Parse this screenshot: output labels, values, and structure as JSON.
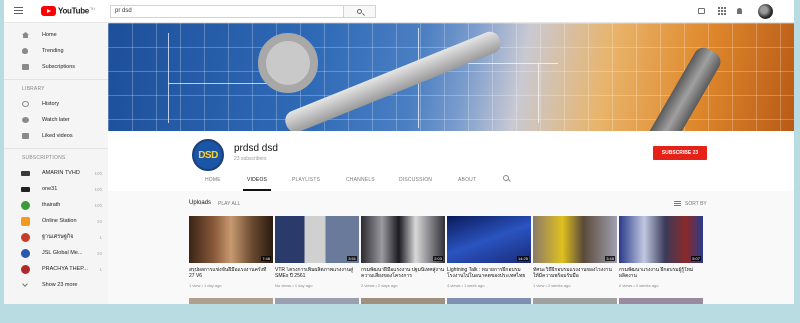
{
  "header": {
    "logo_text": "YouTube",
    "logo_suffix": "TH",
    "search_value": "pr dsd"
  },
  "sidebar": {
    "main": [
      {
        "label": "Home",
        "icon": "home-icon"
      },
      {
        "label": "Trending",
        "icon": "flame-icon"
      },
      {
        "label": "Subscriptions",
        "icon": "subscriptions-icon"
      }
    ],
    "library_heading": "LIBRARY",
    "library": [
      {
        "label": "History",
        "icon": "history-icon"
      },
      {
        "label": "Watch later",
        "icon": "clock-icon"
      },
      {
        "label": "Liked videos",
        "icon": "thumbs-up-icon"
      }
    ],
    "subscriptions_heading": "SUBSCRIPTIONS",
    "subscriptions": [
      {
        "label": "AMARIN TVHD",
        "count": "100",
        "color": "#3a3a3a"
      },
      {
        "label": "one31",
        "count": "100",
        "color": "#222222"
      },
      {
        "label": "thairath",
        "count": "100",
        "color": "#3c9a3a"
      },
      {
        "label": "Online Station",
        "count": "20",
        "color": "#f29a1f"
      },
      {
        "label": "ฐานเศรษฐกิจ",
        "count": "1",
        "color": "#c83c2a"
      },
      {
        "label": "JSL Global Me...",
        "count": "20",
        "color": "#2a56b0"
      },
      {
        "label": "PRACHYA THEP...",
        "count": "1",
        "color": "#b02a2a"
      }
    ],
    "show_more": "Show 23 more"
  },
  "channel": {
    "avatar_text": "DSD",
    "name": "prdsd dsd",
    "subscribers": "23 subscribers",
    "subscribe_label": "SUBSCRIBE 23",
    "tabs": [
      "HOME",
      "VIDEOS",
      "PLAYLISTS",
      "CHANNELS",
      "DISCUSSION",
      "ABOUT"
    ],
    "active_tab": "VIDEOS"
  },
  "uploads": {
    "title": "Uploads",
    "play_all": "PLAY ALL",
    "sort_by": "SORT BY",
    "videos": [
      {
        "title": "สรุปผลการแข่งขันฝีมือแรงงานครั้งที่ 27 V6",
        "meta": "1 view • 1 day ago",
        "duration": "7:48",
        "colors": [
          "#5a3a26",
          "#c8a07a"
        ]
      },
      {
        "title": "VTR โครงการเพิ่มผลิตภาพแรงงานสู่ SMEs ปี 2561",
        "meta": "No views • 1 day ago",
        "duration": "3:51",
        "colors": [
          "#3a4e7a",
          "#dcdcdc"
        ]
      },
      {
        "title": "กรมพัฒนาฝีมือแรงงาน ปฐมนิเทศสู่งานความเสี่ยงของโครงการ",
        "meta": "2 views • 2 days ago",
        "duration": "2:03",
        "colors": [
          "#2a2a30",
          "#cfcfcf"
        ]
      },
      {
        "title": "Lightning Talk : หมายการฝึกอบรมโรงงานไปในอนาคตของประเทศไทย",
        "meta": "4 views • 1 week ago",
        "duration": "14:25",
        "colors": [
          "#1a2a7a",
          "#3a64d0"
        ]
      },
      {
        "title": "ทัศนะวิถีฝึกอบรมแรงงานของโรงงานให้มีความพร้อมรับมือ",
        "meta": "1 view • 2 weeks ago",
        "duration": "3:45",
        "colors": [
          "#6a5a4a",
          "#e0c020"
        ]
      },
      {
        "title": "กรมพัฒนาแรงงาน ฝึกอบรมผู้รู้ใหม่ ผลิตงาน",
        "meta": "0 views • 2 weeks ago",
        "duration": "5:07",
        "colors": [
          "#2a3a8a",
          "#c0c8e0"
        ]
      }
    ]
  }
}
